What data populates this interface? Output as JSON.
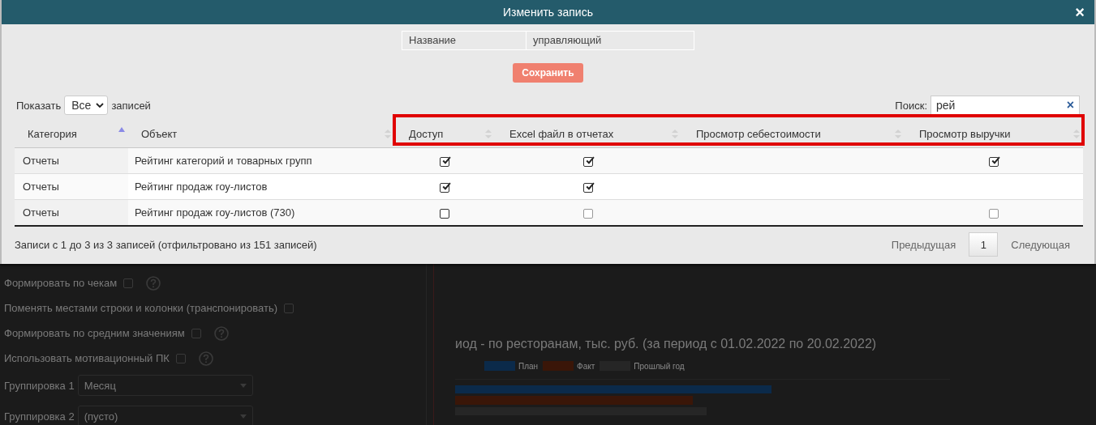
{
  "dialog": {
    "title": "Изменить запись",
    "close": "×",
    "name_field": {
      "label": "Название",
      "value": "управляющий"
    },
    "save_button": "Сохранить",
    "length": {
      "before": "Показать",
      "value": "Все",
      "after": "записей"
    },
    "search": {
      "label": "Поиск:",
      "value": "рей",
      "clear": "×"
    },
    "table": {
      "columns": [
        {
          "label": "Категория",
          "sorted": true,
          "highlighted": false
        },
        {
          "label": "Объект",
          "sorted": false,
          "highlighted": false
        },
        {
          "label": "Доступ",
          "sorted": false,
          "highlighted": true
        },
        {
          "label": "Excel файл в отчетах",
          "sorted": false,
          "highlighted": true
        },
        {
          "label": "Просмотр себестоимости",
          "sorted": false,
          "highlighted": true
        },
        {
          "label": "Просмотр выручки",
          "sorted": false,
          "highlighted": true
        }
      ],
      "rows": [
        {
          "category": "Отчеты",
          "object": "Рейтинг категорий и товарных групп",
          "cells": [
            {
              "kind": "checkbox",
              "checked": true,
              "disabled": false
            },
            {
              "kind": "checkbox",
              "checked": true,
              "disabled": false
            },
            {
              "kind": "empty"
            },
            {
              "kind": "checkbox",
              "checked": true,
              "disabled": false
            }
          ]
        },
        {
          "category": "Отчеты",
          "object": "Рейтинг продаж гоу-листов",
          "cells": [
            {
              "kind": "checkbox",
              "checked": true,
              "disabled": false
            },
            {
              "kind": "checkbox",
              "checked": true,
              "disabled": false
            },
            {
              "kind": "empty"
            },
            {
              "kind": "empty"
            }
          ]
        },
        {
          "category": "Отчеты",
          "object": "Рейтинг продаж гоу-листов (730)",
          "cells": [
            {
              "kind": "checkbox",
              "checked": false,
              "disabled": false
            },
            {
              "kind": "checkbox",
              "checked": false,
              "disabled": true
            },
            {
              "kind": "empty"
            },
            {
              "kind": "checkbox",
              "checked": false,
              "disabled": true
            }
          ]
        }
      ]
    },
    "info": "Записи с 1 до 3 из 3 записей (отфильтровано из 151 записей)",
    "pagination": {
      "previous": "Предыдущая",
      "pages": [
        {
          "label": "1",
          "selected": true
        }
      ],
      "next": "Следующая"
    }
  },
  "background": {
    "options": [
      {
        "label": "Формировать по чекам",
        "checked": false,
        "help": true
      },
      {
        "label": "Поменять местами строки и колонки (транспонировать)",
        "checked": false,
        "help": false
      },
      {
        "label": "Формировать по средним значениям",
        "checked": false,
        "help": true
      },
      {
        "label": "Использовать мотивационный ПК",
        "checked": false,
        "help": true
      }
    ],
    "groupings": [
      {
        "label": "Группировка 1",
        "value": "Месяц"
      },
      {
        "label": "Группировка 2",
        "value": "(пусто)"
      }
    ],
    "chart": {
      "title": "иод - по ресторанам, тыс. руб. (за период с 01.02.2022 по 20.02.2022)",
      "legend": [
        {
          "label": "План",
          "color": "#0b2a4a"
        },
        {
          "label": "Факт",
          "color": "#3a1608"
        },
        {
          "label": "Прошлый год",
          "color": "#262626"
        }
      ]
    }
  }
}
